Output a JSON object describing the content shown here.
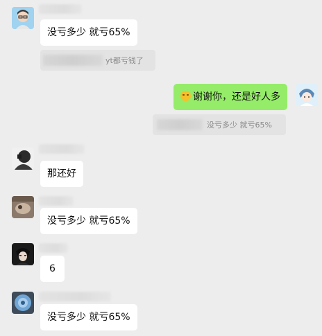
{
  "messages": [
    {
      "text": "没亏多少 就亏65%"
    },
    {
      "quote_suffix": "yt都亏钱了"
    },
    {
      "text": "谢谢你，还是好人多",
      "emoji": "crying-laughing-emoji"
    },
    {
      "quote_text": "没亏多少 就亏65%"
    },
    {
      "text": "那还好"
    },
    {
      "text": "没亏多少 就亏65%"
    },
    {
      "text": "6"
    },
    {
      "text": "没亏多少 就亏65%"
    }
  ],
  "colors": {
    "background": "#ededed",
    "bubble_other": "#ffffff",
    "bubble_me": "#95ec69"
  }
}
